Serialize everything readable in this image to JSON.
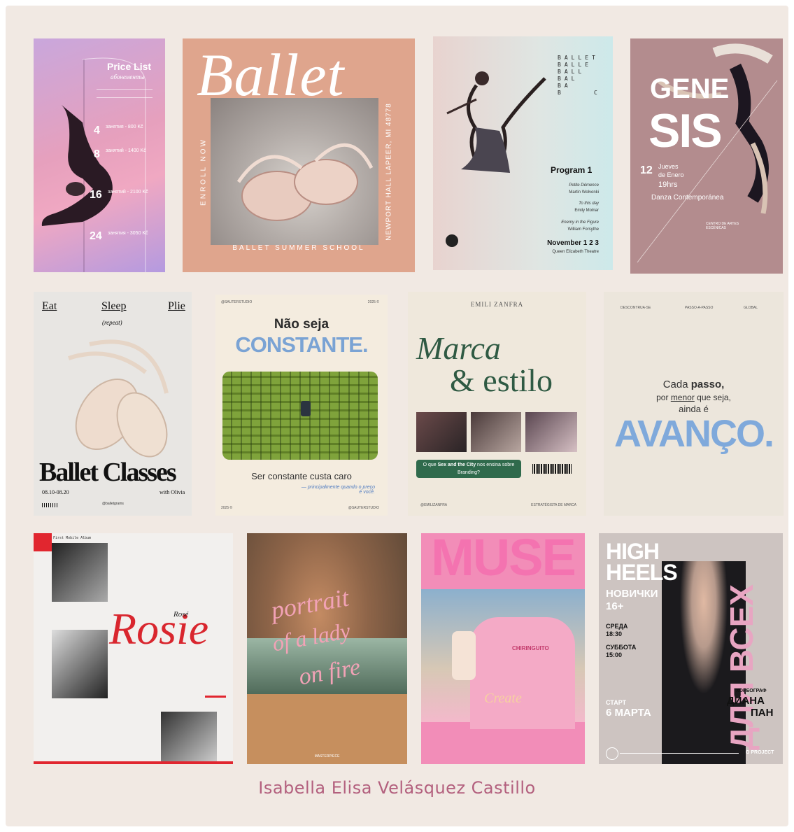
{
  "credit": "Isabella Elisa Velásquez Castillo",
  "posters": {
    "price_list": {
      "title": "Price List",
      "sub": "абонементы",
      "tiers": [
        {
          "n": "4",
          "text": "занятия - 800 Kč"
        },
        {
          "n": "8",
          "text": "занятий - 1400 Kč"
        },
        {
          "n": "16",
          "text": "занятий - 2100 Kč"
        },
        {
          "n": "24",
          "text": "занятия - 3050 Kč"
        }
      ]
    },
    "ballet_summer": {
      "title": "Ballet",
      "left_vertical": "ENROLL NOW",
      "right_vertical": "NEWPORT HALL LAPEER, MI 48778",
      "bottom": "BALLET SUMMER SCHOOL"
    },
    "program": {
      "stack": [
        "BALLET",
        "BALLE",
        "BALL",
        "BAL",
        "BA",
        "B"
      ],
      "stack_c": "C",
      "title": "Program 1",
      "items": [
        {
          "piece": "Petite Démence",
          "who": "Martin Wolvonki"
        },
        {
          "piece": "To this day",
          "who": "Emily Molnar"
        },
        {
          "piece": "Enemy in the Figure",
          "who": "William Forsythe"
        }
      ],
      "date": "November 1 2 3",
      "venue": "Queen Elizabeth Theatre"
    },
    "genesis": {
      "line1": "GENE",
      "line2": "SIS",
      "day": "12",
      "date_text_1": "Jueves",
      "date_text_2": "de Enero",
      "time": "19hrs",
      "genre": "Danza Contemporánea",
      "center": "CENTRO DE ARTES ESCÉNICAS"
    },
    "ballet_classes": {
      "eat": "Eat",
      "sleep": "Sleep",
      "plie": "Plie",
      "repeat": "(repeat)",
      "title": "Ballet Classes",
      "dates": "08.10-08.20",
      "with": "with Olivia",
      "handle": "@balletgrams"
    },
    "constante": {
      "top_left": "@SAUTERSTUDIO",
      "top_right": "2025 ©",
      "pre": "Não seja",
      "headline": "CONSTANTE.",
      "caption": "Ser constante custa caro",
      "script": "— principalmente quando o preço é você.",
      "bottom_left": "2025 ©",
      "bottom_right": "@SAUTERSTUDIO"
    },
    "marca": {
      "brand": "EMILI ZANFRA",
      "line1": "Marca",
      "line2": "& estilo",
      "cta_pre": "O que ",
      "cta_em": "Sex and the City",
      "cta_post": " nos ensina sobre Branding?",
      "bottom_left": "@EMILIZANFRA",
      "bottom_right": "ESTRATÉGISTA DE MARCA"
    },
    "avanco": {
      "tl": "DESCONTRUA-SE",
      "tc": "PASSO-A-PASSO",
      "tr": "GLOBAL",
      "line1_a": "Cada ",
      "line1_b": "passo,",
      "line2_a": "por ",
      "line2_b": "menor",
      "line2_c": " que seja,",
      "line3": "ainda é",
      "headline": "AVANÇO."
    },
    "rosie": {
      "title": "Rosie",
      "small": "Rosé",
      "top_text": "First Mobile Album"
    },
    "portrait": {
      "l1": "portrait",
      "l2": "of a lady",
      "l3": "on fire",
      "studio": "MASTERPIECE"
    },
    "muse": {
      "title": "MUSE",
      "shirt": "CHIRINGUITO",
      "script": "Create"
    },
    "high_heels": {
      "l1": "HIGH",
      "l2": "HEELS",
      "novice": "НОВИЧКИ",
      "age": "16+",
      "day1": "СРЕДА",
      "time1": "18:30",
      "day2": "СУББОТА",
      "time2": "15:00",
      "start": "СТАРТ",
      "start_date": "6 МАРТА",
      "role": "ХОРЕОГРАФ",
      "name1": "ДИАНА",
      "name2": "ПАН",
      "vertical": "ДЛЯ ВСЕХ",
      "brand": "G PROJECT"
    }
  }
}
